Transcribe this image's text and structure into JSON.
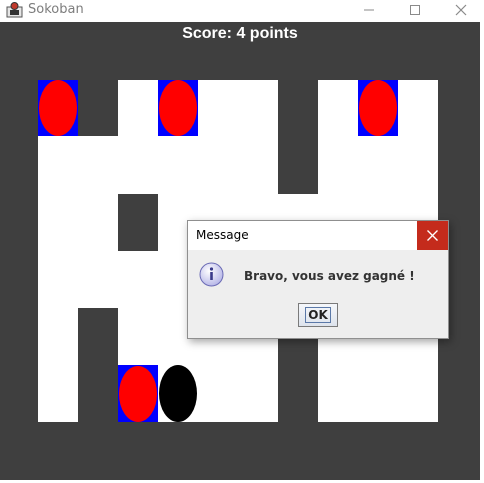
{
  "window": {
    "title": "Sokoban"
  },
  "game": {
    "score_text": "Score: 4 points",
    "colors": {
      "wall": "#3f3f3f",
      "floor": "#ffffff",
      "target": "#0000ff",
      "box": "#ff0000",
      "player": "#000000"
    }
  },
  "dialog": {
    "title": "Message",
    "message": "Bravo, vous avez gagné !",
    "ok_label": "OK",
    "icon": "info-icon"
  }
}
